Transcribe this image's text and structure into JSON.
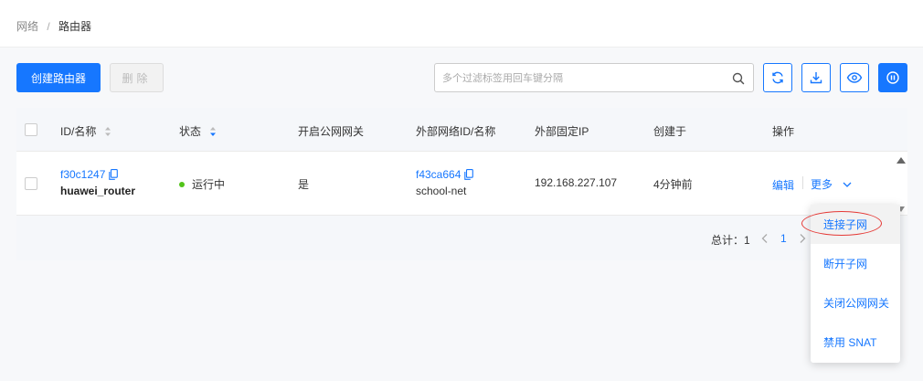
{
  "breadcrumb": {
    "parent": "网络",
    "separator": "/",
    "current": "路由器"
  },
  "toolbar": {
    "create_label": "创建路由器",
    "delete_label": "删除",
    "search_placeholder": "多个过滤标签用回车键分隔",
    "icons": [
      "refresh-icon",
      "download-icon",
      "eye-icon",
      "pause-icon"
    ]
  },
  "table": {
    "columns": [
      "ID/名称",
      "状态",
      "开启公网网关",
      "外部网络ID/名称",
      "外部固定IP",
      "创建于",
      "操作"
    ],
    "rows": [
      {
        "id": "f30c1247",
        "name": "huawei_router",
        "status": "运行中",
        "public_gateway": "是",
        "ext_net_id": "f43ca664",
        "ext_net_name": "school-net",
        "ext_ip": "192.168.227.107",
        "created": "4分钟前",
        "action_edit": "编辑",
        "action_more": "更多"
      }
    ],
    "footer": {
      "total_label": "总计：",
      "total_value": "1",
      "current_page": "1"
    }
  },
  "dropdown": {
    "items": [
      "连接子网",
      "断开子网",
      "关闭公网网关",
      "禁用 SNAT"
    ]
  },
  "colors": {
    "primary": "#1677ff",
    "success": "#52c41a",
    "annotation": "#e53935"
  }
}
